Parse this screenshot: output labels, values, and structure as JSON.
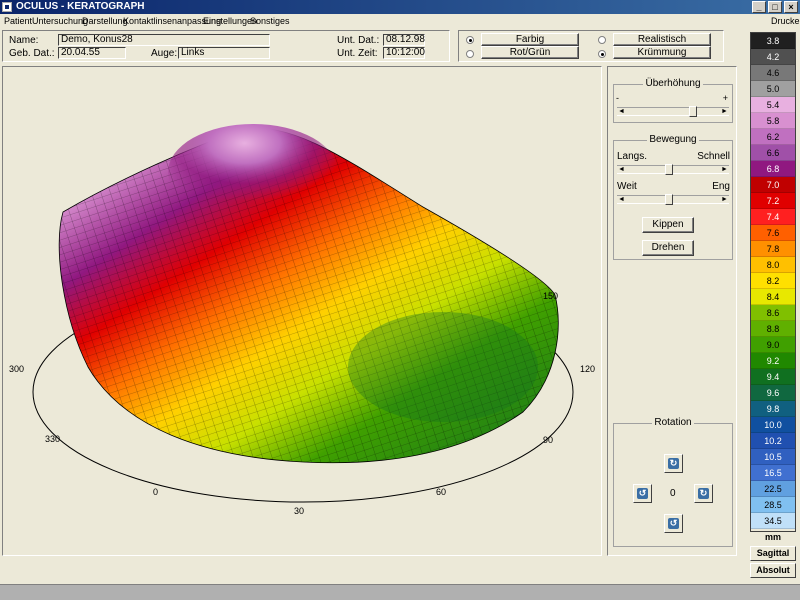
{
  "window": {
    "title": "OCULUS  -  KERATOGRAPH",
    "minimize": "_",
    "maximize": "□",
    "close": "×"
  },
  "menu": {
    "items": [
      "Patient",
      "Untersuchung",
      "Darstellung",
      "Kontaktlinsenanpassung",
      "Einstellungen",
      "Sonstiges"
    ],
    "print": "Drucken"
  },
  "patient": {
    "name_label": "Name:",
    "name_value": "Demo, Konus28",
    "dob_label": "Geb. Dat.:",
    "dob_value": "20.04.55",
    "eye_label": "Auge:",
    "eye_value": "Links",
    "exam_date_label": "Unt. Dat.:",
    "exam_date_value": "08.12.98",
    "exam_time_label": "Unt. Zeit:",
    "exam_time_value": "10:12:00"
  },
  "display_mode": {
    "farbig": "Farbig",
    "rotgruen": "Rot/Grün",
    "realistisch": "Realistisch",
    "kruemmung": "Krümmung"
  },
  "controls": {
    "ueberhoehung_title": "Überhöhung",
    "ueberhoehung_minus": "-",
    "ueberhoehung_plus": "+",
    "ueberhoehung_level": 0.74,
    "bewegung_title": "Bewegung",
    "langs": "Langs.",
    "schnell": "Schnell",
    "speed_level": 0.45,
    "weit": "Weit",
    "eng": "Eng",
    "distance_level": 0.45,
    "kippen": "Kippen",
    "drehen": "Drehen",
    "rotation_title": "Rotation",
    "rotation_value": "0"
  },
  "axis_labels": [
    "0",
    "30",
    "60",
    "90",
    "120",
    "150",
    "300",
    "330"
  ],
  "scale": {
    "values": [
      "3.8",
      "4.2",
      "4.6",
      "5.0",
      "5.4",
      "5.8",
      "6.2",
      "6.6",
      "6.8",
      "7.0",
      "7.2",
      "7.4",
      "7.6",
      "7.8",
      "8.0",
      "8.2",
      "8.4",
      "8.6",
      "8.8",
      "9.0",
      "9.2",
      "9.4",
      "9.6",
      "9.8",
      "10.0",
      "10.2",
      "10.5",
      "16.5",
      "22.5",
      "28.5",
      "34.5"
    ],
    "colors": [
      "#202020",
      "#505050",
      "#787878",
      "#a0a0a0",
      "#e8b0e0",
      "#d890d0",
      "#c070c0",
      "#a050a8",
      "#901880",
      "#c00000",
      "#e00000",
      "#ff2020",
      "#ff6000",
      "#ff9000",
      "#ffc000",
      "#ffe000",
      "#e8e800",
      "#80c000",
      "#60b000",
      "#40a000",
      "#208800",
      "#107020",
      "#106840",
      "#106080",
      "#1050a0",
      "#2050b0",
      "#3060c0",
      "#4070d0",
      "#60a0e0",
      "#80c0f0",
      "#c0e0f8"
    ],
    "unit": "mm",
    "sagittal": "Sagittal",
    "absolut": "Absolut"
  }
}
